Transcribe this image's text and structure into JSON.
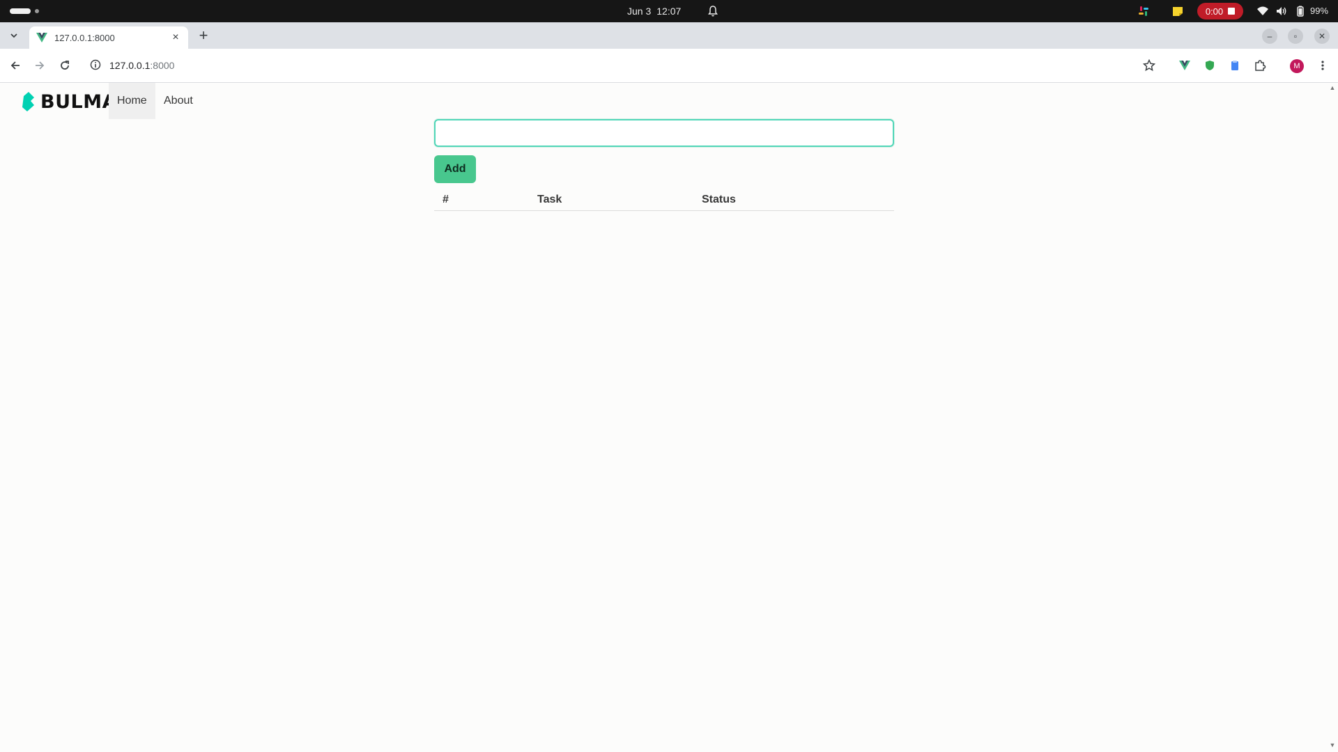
{
  "system_bar": {
    "date": "Jun 3",
    "time": "12:07",
    "recording_timer": "0:00",
    "battery_percent": "99%"
  },
  "browser": {
    "tab_title": "127.0.0.1:8000",
    "url_host": "127.0.0.1",
    "url_port": ":8000",
    "profile_initial": "M",
    "accent_color": "#c2185b"
  },
  "navbar": {
    "brand": "BULMA",
    "brand_color": "#00d1b2",
    "items": [
      {
        "label": "Home",
        "active": true
      },
      {
        "label": "About",
        "active": false
      }
    ]
  },
  "form": {
    "input_value": "",
    "input_placeholder": "",
    "add_label": "Add",
    "primary_color": "#48c78e"
  },
  "table": {
    "headers": [
      "#",
      "Task",
      "Status"
    ],
    "rows": []
  }
}
